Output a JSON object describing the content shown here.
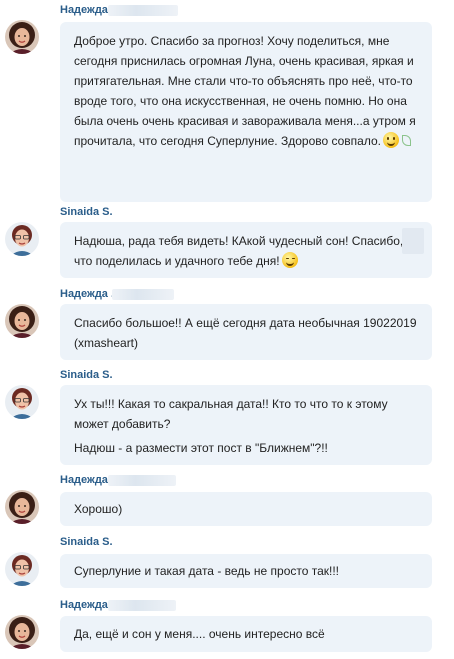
{
  "messages": [
    {
      "author": "Надежда",
      "paragraphs": [
        "Доброе утро. Спасибо за прогноз! Хочу поделиться, мне сегодня приснилась огромная Луна, очень красивая, яркая и притягательная. Мне стали что-то объяснять про неё, что-то вроде того, что она искусственная, не очень помню. Но она была очень очень красивая и завораживала меня...а утром я прочитала, что сегодня Суперлуние. Здорово совпало."
      ],
      "emoticon": "smile-icon"
    },
    {
      "author": "Sinaida S.",
      "paragraphs": [
        "Надюша, рада тебя видеть! КАкой чудесный сон! Спасибо, что поделилась и удачного тебе дня!"
      ],
      "emoticon": "wink-icon"
    },
    {
      "author": "Надежда .",
      "paragraphs": [
        "Спасибо большое!! А ещё сегодня дата необычная 19022019 (xmasheart)"
      ]
    },
    {
      "author": "Sinaida S.",
      "paragraphs": [
        "Ух ты!!! Какая то сакральная дата!! Кто то что то к этому может добавить?",
        "Надюш - а размести этот пост в \"Ближнем\"?!!"
      ]
    },
    {
      "author": "Надежда",
      "paragraphs": [
        "Хорошо)"
      ]
    },
    {
      "author": "Sinaida S.",
      "paragraphs": [
        "Суперлуние и такая дата - ведь не просто так!!!"
      ]
    },
    {
      "author": "Надежда",
      "paragraphs": [
        "Да, ещё и сон у меня.... очень интересно всё"
      ]
    }
  ]
}
